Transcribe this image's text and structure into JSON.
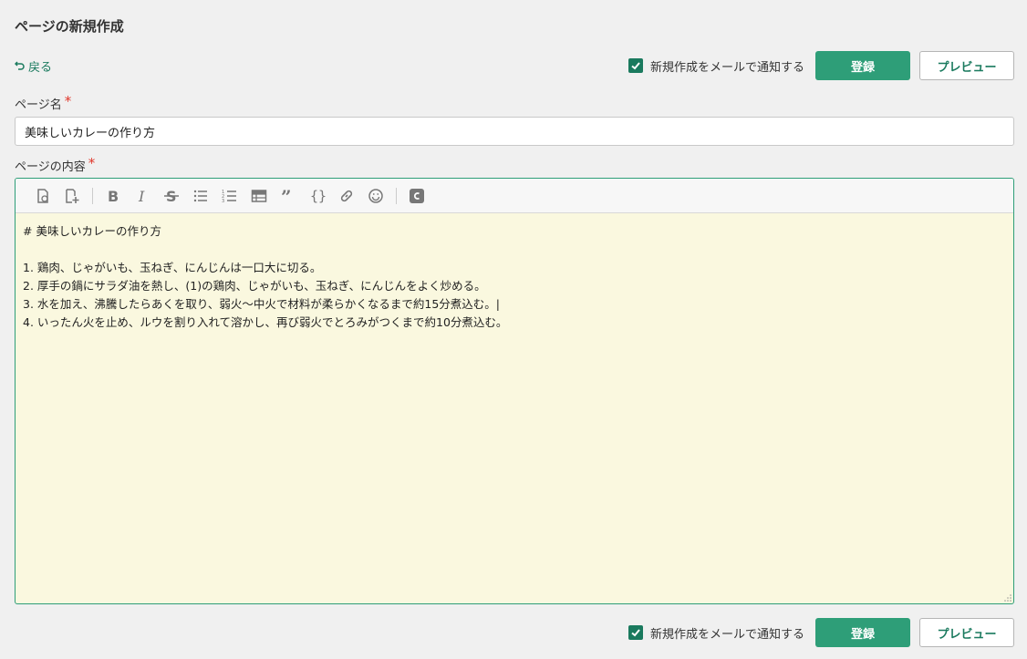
{
  "page": {
    "title": "ページの新規作成"
  },
  "nav": {
    "back_label": "戻る"
  },
  "actions": {
    "notify_label": "新規作成をメールで通知する",
    "notify_checked": true,
    "submit_label": "登録",
    "preview_label": "プレビュー"
  },
  "form": {
    "name_label": "ページ名",
    "required_mark": "*",
    "name_value": "美味しいカレーの作り方",
    "content_label": "ページの内容",
    "content_value": "# 美味しいカレーの作り方\n\n1. 鶏肉、じゃがいも、玉ねぎ、にんじんは一口大に切る。\n2. 厚手の鍋にサラダ油を熱し、(1)の鶏肉、じゃがいも、玉ねぎ、にんじんをよく炒める。\n3. 水を加え、沸騰したらあくを取り、弱火～中火で材料が柔らかくなるまで約15分煮込む。|\n4. いったん火を止め、ルウを割り入れて溶かし、再び弱火でとろみがつくまで約10分煮込む。"
  },
  "toolbar": {
    "icons": [
      "attach-file-icon",
      "add-page-icon",
      "bold-icon",
      "italic-icon",
      "strikethrough-icon",
      "bullet-list-icon",
      "numbered-list-icon",
      "table-icon",
      "quote-icon",
      "code-icon",
      "link-icon",
      "emoji-icon",
      "custom-c-icon"
    ]
  },
  "colors": {
    "accent": "#2e9e78",
    "link": "#1a7a5e",
    "required": "#e0362a",
    "editor_bg": "#faf8df"
  }
}
